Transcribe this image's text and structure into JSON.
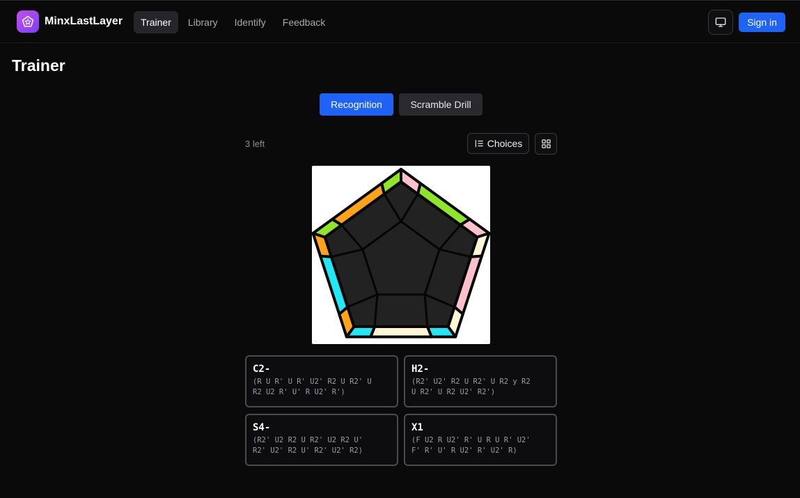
{
  "app": {
    "brand": "MinxLastLayer",
    "logo_icon": "pentagon-star-icon",
    "accent": "#1e63f5"
  },
  "nav": {
    "items": [
      {
        "label": "Trainer",
        "active": true
      },
      {
        "label": "Library",
        "active": false
      },
      {
        "label": "Identify",
        "active": false
      },
      {
        "label": "Feedback",
        "active": false
      }
    ]
  },
  "header": {
    "display_icon": "monitor-icon",
    "sign_in_label": "Sign in"
  },
  "page": {
    "title": "Trainer"
  },
  "modes": {
    "recognition_label": "Recognition",
    "scramble_label": "Scramble Drill",
    "selected": "Recognition"
  },
  "session": {
    "remaining": "3 left",
    "choices_label": "Choices",
    "choices_icon": "list-ordered-icon",
    "grid_icon": "grid-icon"
  },
  "puzzle": {
    "face_color": "#222222",
    "edge_colors": [
      "#ffc0cb",
      "#8ee52a",
      "#ffc0cb",
      "#fff6d6",
      "#ffc0cb",
      "#fff6d6",
      "#22e8f5",
      "#fff6d6",
      "#22e8f5",
      "#ffa419",
      "#22e8f5",
      "#ffa419",
      "#8ee52a",
      "#ffa419",
      "#8ee52a"
    ]
  },
  "answers": [
    {
      "name": "C2-",
      "alg_line1": "(R U R' U R' U2' R2 U R2' U",
      "alg_line2": "R2 U2 R' U' R U2' R')"
    },
    {
      "name": "H2-",
      "alg_line1": "(R2' U2' R2 U R2' U R2 y R2",
      "alg_line2": "U R2' U R2 U2' R2')"
    },
    {
      "name": "S4-",
      "alg_line1": "(R2' U2 R2 U R2' U2 R2 U'",
      "alg_line2": "R2' U2' R2 U' R2' U2' R2)"
    },
    {
      "name": "X1",
      "alg_line1": "(F U2 R U2' R' U R U R' U2'",
      "alg_line2": "F' R' U' R U2' R' U2' R)"
    }
  ]
}
